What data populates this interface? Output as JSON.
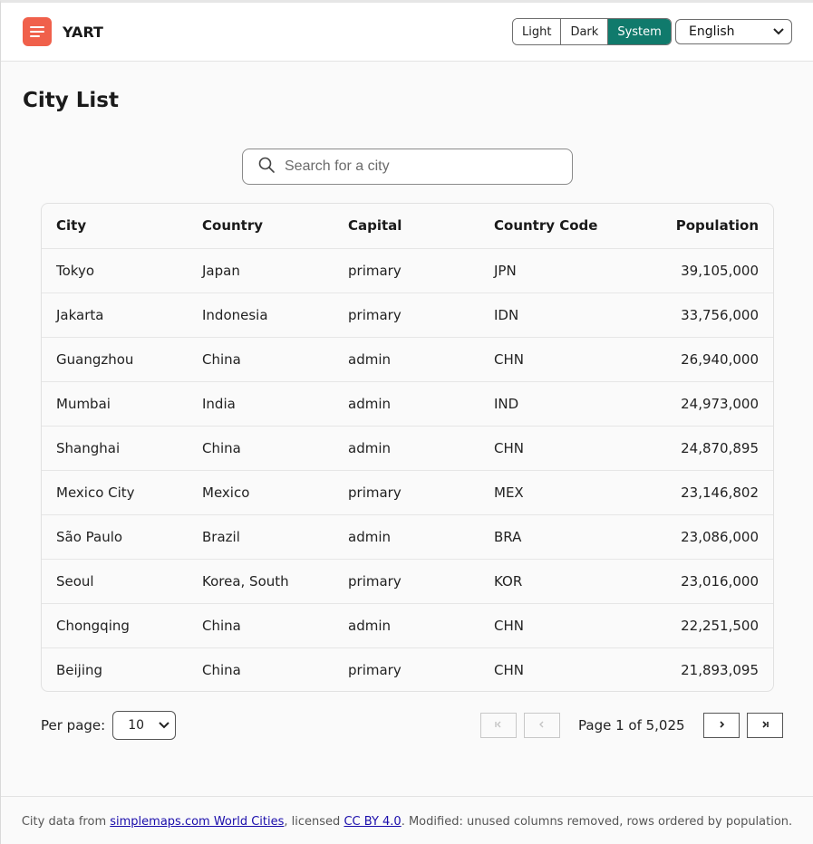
{
  "header": {
    "brand": "YART",
    "theme_options": [
      "Light",
      "Dark",
      "System"
    ],
    "theme_selected": "System",
    "language": "English"
  },
  "page_title": "City List",
  "search": {
    "placeholder": "Search for a city",
    "value": ""
  },
  "table": {
    "columns": [
      "City",
      "Country",
      "Capital",
      "Country Code",
      "Population"
    ],
    "rows": [
      [
        "Tokyo",
        "Japan",
        "primary",
        "JPN",
        "39,105,000"
      ],
      [
        "Jakarta",
        "Indonesia",
        "primary",
        "IDN",
        "33,756,000"
      ],
      [
        "Guangzhou",
        "China",
        "admin",
        "CHN",
        "26,940,000"
      ],
      [
        "Mumbai",
        "India",
        "admin",
        "IND",
        "24,973,000"
      ],
      [
        "Shanghai",
        "China",
        "admin",
        "CHN",
        "24,870,895"
      ],
      [
        "Mexico City",
        "Mexico",
        "primary",
        "MEX",
        "23,146,802"
      ],
      [
        "São Paulo",
        "Brazil",
        "admin",
        "BRA",
        "23,086,000"
      ],
      [
        "Seoul",
        "Korea, South",
        "primary",
        "KOR",
        "23,016,000"
      ],
      [
        "Chongqing",
        "China",
        "admin",
        "CHN",
        "22,251,500"
      ],
      [
        "Beijing",
        "China",
        "primary",
        "CHN",
        "21,893,095"
      ]
    ]
  },
  "pagination": {
    "per_page_label": "Per page:",
    "per_page_value": "10",
    "page_info": "Page 1 of 5,025",
    "first_icon": "first-page-icon",
    "prev_icon": "prev-page-icon",
    "next_icon": "next-page-icon",
    "last_icon": "last-page-icon"
  },
  "footer": {
    "prefix": "City data from ",
    "link1": "simplemaps.com World Cities",
    "middle": ", licensed ",
    "link2": "CC BY 4.0",
    "suffix": ". Modified: unused columns removed, rows ordered by population."
  },
  "colors": {
    "accent": "#107a6c",
    "logo": "#f0604b"
  }
}
